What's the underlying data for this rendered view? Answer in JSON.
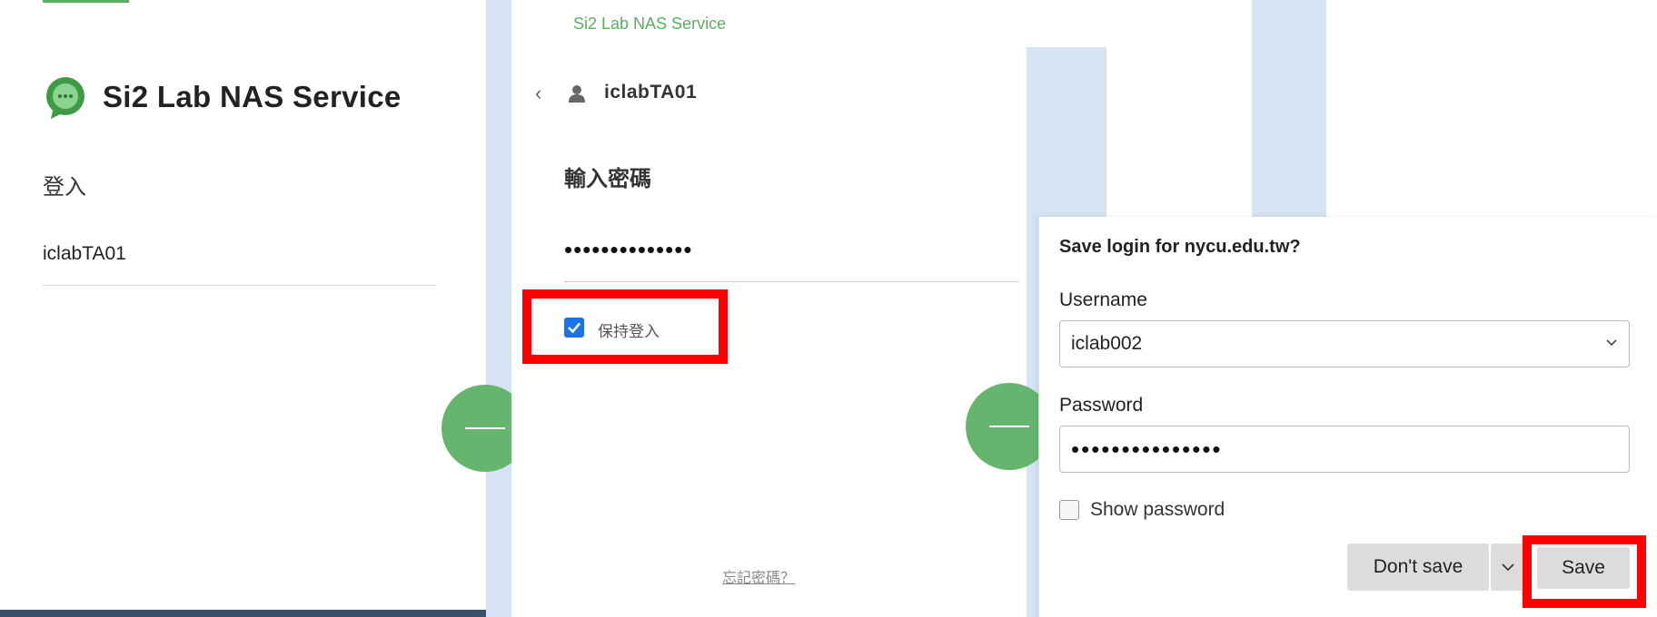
{
  "panel1": {
    "brand_title": "Si2 Lab NAS Service",
    "login_heading": "登入",
    "username": "iclabTA01"
  },
  "panel2": {
    "brand": "Si2 Lab NAS Service",
    "back_glyph": "‹",
    "username": "iclabTA01",
    "heading": "輸入密碼",
    "password_masked": "••••••••••••••",
    "keep_signed_in": "保持登入",
    "keep_signed_in_checked": true,
    "forgot_password": "忘記密碼？"
  },
  "dialog": {
    "title": "Save login for nycu.edu.tw?",
    "username_label": "Username",
    "username_value": "iclab002",
    "password_label": "Password",
    "password_masked": "•••••••••••••••",
    "show_password_label": "Show password",
    "show_password_checked": false,
    "dont_save_label": "Don't save",
    "save_label": "Save"
  },
  "icons": {
    "logo": "chat-bubble-icon",
    "back": "chevron-left-icon",
    "user": "user-icon",
    "dropdown": "chevron-down-icon"
  },
  "colors": {
    "accent_green": "#5aae64",
    "highlight_red": "#ff0000",
    "checkbox_blue": "#1a73e8"
  }
}
